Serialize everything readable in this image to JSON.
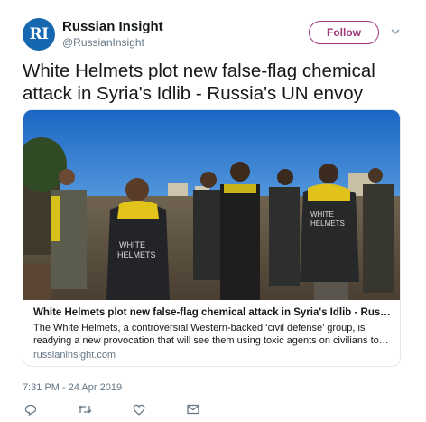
{
  "account": {
    "avatar_text": "RI",
    "name": "Russian Insight",
    "handle": "@RussianInsight",
    "follow_label": "Follow"
  },
  "tweet": {
    "text": "White Helmets plot new false-flag chemical attack in Syria's Idlib - Russia's UN envoy",
    "timestamp": "7:31 PM - 24 Apr 2019"
  },
  "card": {
    "title": "White Helmets plot new false-flag chemical attack in Syria's Idlib - Russia's UN envoy",
    "description": "The White Helmets, a controversial Western-backed ‘civil defense’ group, is readying a new provocation that will see them using toxic agents on civilians to frame the Syrian government.",
    "domain": "russianinsight.com",
    "vest_text_1": "WHITE\nHELMETS",
    "vest_text_2": "WHITE\nHELMETS"
  },
  "actions": [
    {
      "icon": "reply-icon"
    },
    {
      "icon": "retweet-icon"
    },
    {
      "icon": "like-icon"
    },
    {
      "icon": "direct-message-icon"
    }
  ],
  "colors": {
    "accent": "#a0397a",
    "avatar_bg": "#1567b0",
    "secondary_text": "#657786",
    "border": "#e1e8ed"
  }
}
